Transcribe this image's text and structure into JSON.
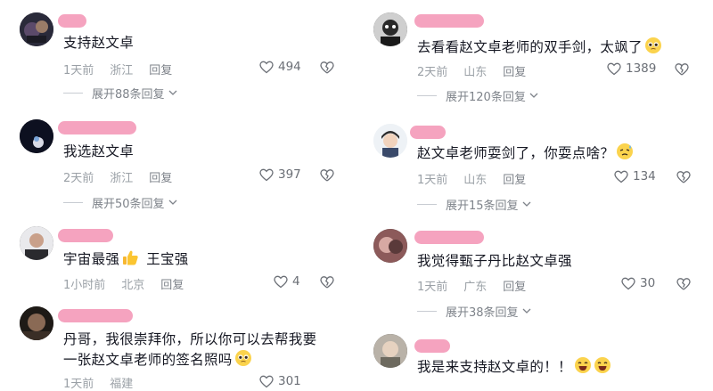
{
  "reply_label": "回复",
  "left": [
    {
      "text": "支持赵文卓",
      "time": "1天前",
      "location": "浙江",
      "likes": "494",
      "expand": "展开88条回复",
      "emoji": ""
    },
    {
      "text": "我选赵文卓",
      "time": "2天前",
      "location": "浙江",
      "likes": "397",
      "expand": "展开50条回复",
      "emoji": ""
    },
    {
      "text": "宇宙最强",
      "text2": "王宝强",
      "time": "1小时前",
      "location": "北京",
      "likes": "4",
      "expand": "",
      "emoji": "thumbs-up"
    },
    {
      "text": "丹哥，我很崇拜你，所以你可以去帮我要",
      "text_line2": "一张赵文卓老师的签名照吗",
      "time": "1天前",
      "location": "福建",
      "likes": "301",
      "expand": "",
      "emoji": "pleading"
    }
  ],
  "right": [
    {
      "text": "去看看赵文卓老师的双手剑，太飒了",
      "time": "2天前",
      "location": "山东",
      "likes": "1389",
      "expand": "展开120条回复",
      "emoji": "pleading"
    },
    {
      "text": "赵文卓老师耍剑了，你耍点啥？",
      "time": "1天前",
      "location": "山东",
      "likes": "134",
      "expand": "展开15条回复",
      "emoji": "sweat"
    },
    {
      "text": "我觉得甄子丹比赵文卓强",
      "time": "1天前",
      "location": "广东",
      "likes": "30",
      "expand": "展开38条回复",
      "emoji": ""
    },
    {
      "text": "我是来支持赵文卓的！！",
      "time": "",
      "location": "",
      "likes": "",
      "expand": "",
      "emoji": "laugh"
    }
  ]
}
